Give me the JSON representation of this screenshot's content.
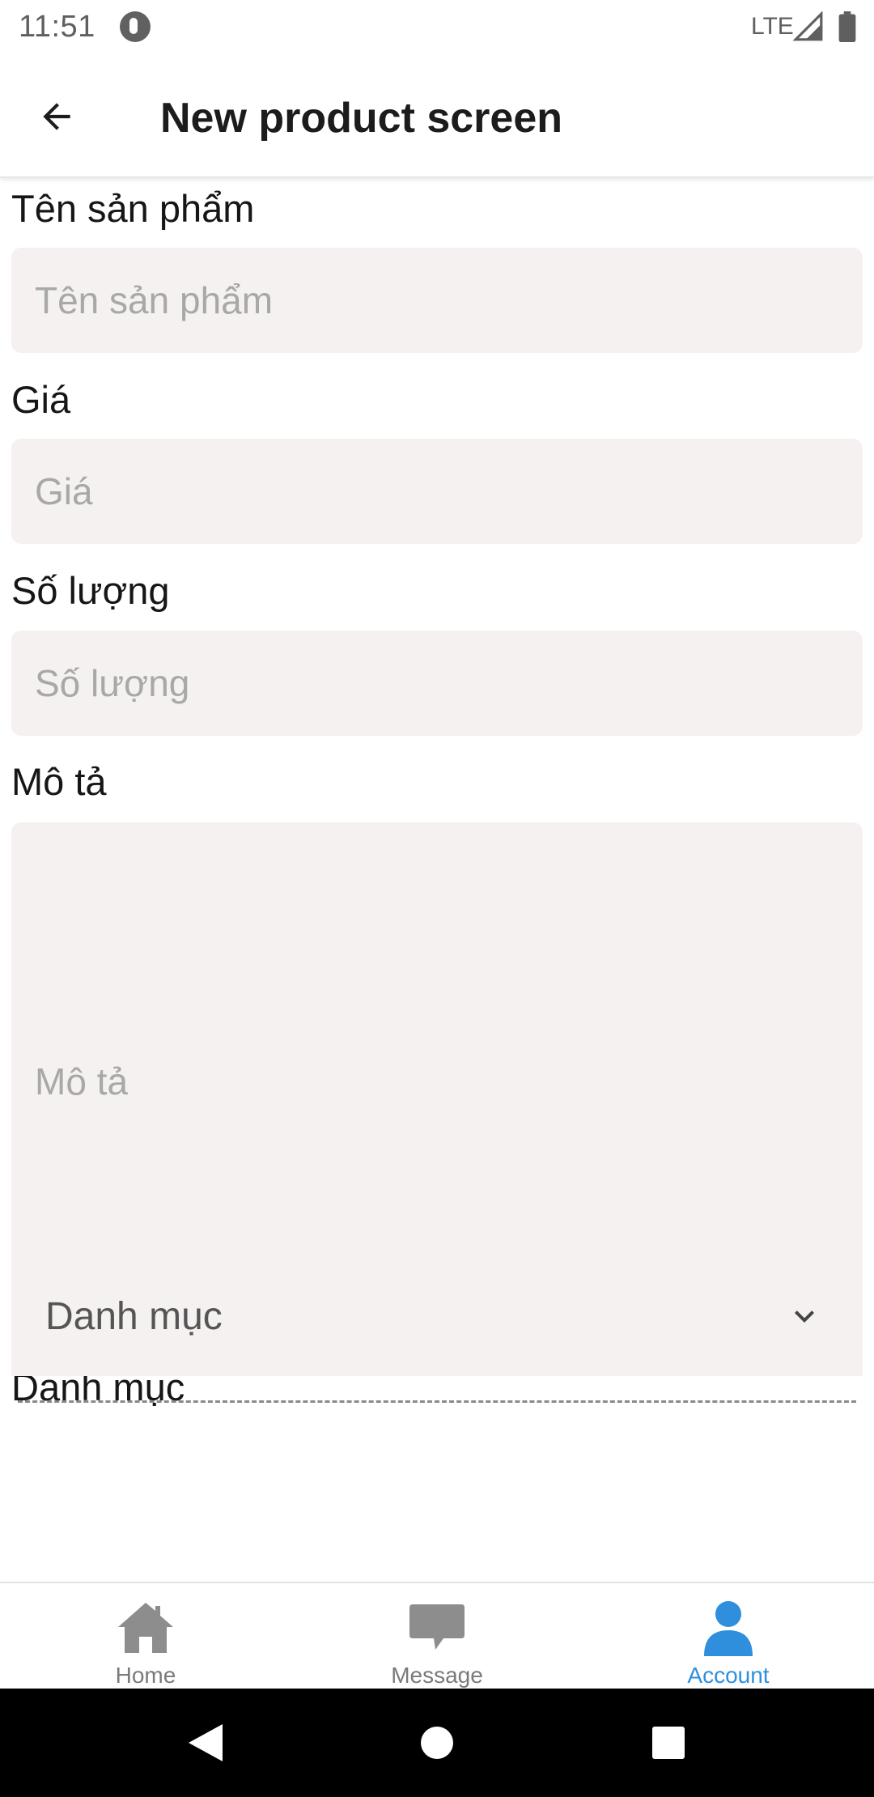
{
  "status_bar": {
    "time": "11:51",
    "network": "LTE"
  },
  "app_bar": {
    "title": "New product screen"
  },
  "form": {
    "name": {
      "label": "Tên sản phẩm",
      "placeholder": "Tên sản phẩm",
      "value": ""
    },
    "price": {
      "label": "Giá",
      "placeholder": "Giá",
      "value": ""
    },
    "quantity": {
      "label": "Số lượng",
      "placeholder": "Số lượng",
      "value": ""
    },
    "description": {
      "label": "Mô tả",
      "placeholder": "Mô tả",
      "value": ""
    },
    "category": {
      "label": "Danh mục",
      "selected": "Danh mục"
    }
  },
  "bottom_nav": {
    "items": [
      {
        "label": "Home",
        "icon": "home-icon",
        "active": false
      },
      {
        "label": "Message",
        "icon": "message-icon",
        "active": false
      },
      {
        "label": "Account",
        "icon": "account-icon",
        "active": true
      }
    ]
  },
  "colors": {
    "accent": "#2f8fdc",
    "input_bg": "#f5f1f0",
    "inactive_icon": "#8d8d8d"
  }
}
